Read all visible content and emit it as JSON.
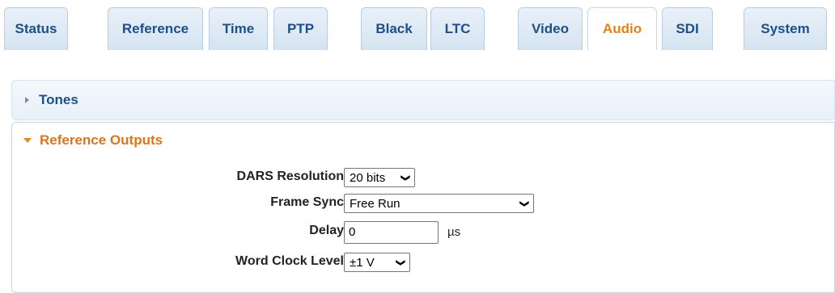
{
  "tabs": [
    {
      "label": "Status",
      "active": false
    },
    {
      "label": "Reference",
      "active": false
    },
    {
      "label": "Time",
      "active": false
    },
    {
      "label": "PTP",
      "active": false
    },
    {
      "label": "Black",
      "active": false
    },
    {
      "label": "LTC",
      "active": false
    },
    {
      "label": "Video",
      "active": false
    },
    {
      "label": "Audio",
      "active": true
    },
    {
      "label": "SDI",
      "active": false
    },
    {
      "label": "System",
      "active": false
    }
  ],
  "sections": {
    "tones": {
      "label": "Tones",
      "expanded": false
    },
    "reference_outputs": {
      "label": "Reference Outputs",
      "expanded": true,
      "fields": {
        "dars_resolution": {
          "label": "DARS Resolution",
          "value": "20 bits"
        },
        "frame_sync": {
          "label": "Frame Sync",
          "value": "Free Run"
        },
        "delay": {
          "label": "Delay",
          "value": "0",
          "unit": "µs"
        },
        "word_clock_level": {
          "label": "Word Clock Level",
          "value": "±1 V"
        }
      }
    }
  },
  "colors": {
    "tab_text": "#1d4f8a",
    "active_tab_text": "#e2811a",
    "section_header_active": "#d9761a"
  },
  "icons": {
    "collapsed": "triangle-right-icon",
    "expanded": "triangle-down-icon",
    "dropdown": "chevron-down-icon"
  }
}
